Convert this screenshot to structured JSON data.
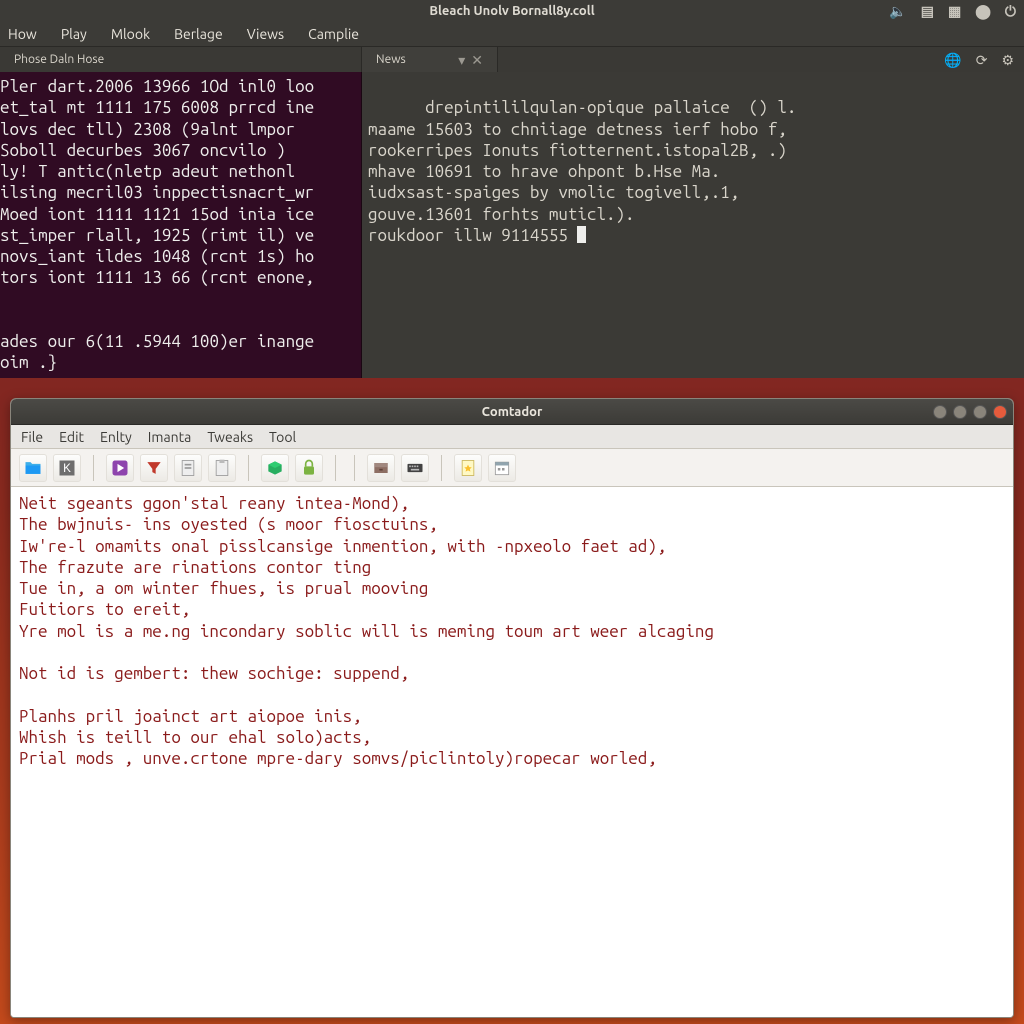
{
  "panel": {
    "title": "Bleach Unolv Bornall8y.coll",
    "tray_icons": [
      "volume-icon",
      "user-icon",
      "grid-icon",
      "network-icon",
      "power-icon"
    ]
  },
  "terminal": {
    "menu": [
      "How",
      "Play",
      "Mlook",
      "Berlage",
      "Views",
      "Camplie"
    ],
    "tabs": {
      "left": {
        "label": "Phose Daln Hose"
      },
      "right": {
        "label": "News",
        "controls": [
          "chevron-down",
          "close"
        ]
      },
      "far_icons": [
        "globe-icon",
        "refresh-icon",
        "gear-icon"
      ]
    },
    "pane_left": "Pler dart.2006 13966 1Od inl0 loo\net_tal mt 1111 175 6008 prrcd ine\nlovs dec tll) 2308 (9alnt lmpor\nSoboll decurbes 3067 oncvilo )\nly! T antic(nletp adeut nethonl\nilsing mecril03 inppectisnacrt_wr\nMoed iont 1111 1121 15od inia ice\nst_imper rlall, 1925 (rimt il) ve\nnovs_iant ildes 1048 (rcnt 1s) ho\ntors iont 1111 13 66 (rcnt enone,\n\n\nades our 6(11 .5944 100)er inange\noim .}",
    "pane_right": "drepintililqulan-opique pallaice  () l.\nmaame 15603 to chniiage detness ierf hobo f,\nrookerripes Ionuts fiotternent.istopal2B, .)\nmhave 10691 to hrave ohpont b.Hse Ma.\niudxsast-spaiges by vmolic togivell,.1,\ngouve.13601 forhts muticl.).\nroukdoor illw 9114555 "
  },
  "editor": {
    "title": "Comtador",
    "menu": [
      "File",
      "Edit",
      "Enlty",
      "Imanta",
      "Tweaks",
      "Tool"
    ],
    "toolbar_icons": [
      "folder-open-icon",
      "k-square-icon",
      "sep",
      "play-purple-icon",
      "filter-red-icon",
      "doc-info-icon",
      "doc-paste-icon",
      "sep",
      "box-green-icon",
      "lock-green-icon",
      "sep",
      "sep",
      "drawer-icon",
      "keyboard-icon",
      "sep",
      "doc-star-icon",
      "calendar-icon"
    ],
    "content": "Neit sgeants ggon'stal reany intea-Mond),\nThe bwjnuis- ins oyested (s moor fiosctuins,\nIw're-l omamits onal pisslcansige inmention, with -npxeolo faet ad),\nThe frazute are rinations contor ting\nTue in, a om winter fhues, is prual mooving\nFuitiors to ereit,\nYre mol is a me.ng incondary soblic will is meming toum art weer alcaging\n\nNot id is gembert: thew sochige: suppend,\n\nPlanhs pril joainct art aiopoe inis,\nWhish is teill to our ehal solo)acts,\nPrial mods , unve.crtone mpre-dary somvs/piclintoly)ropecar worled,"
  },
  "icon_glyphs": {
    "volume-icon": "🔈",
    "user-icon": "▤",
    "grid-icon": "▦",
    "network-icon": "⬤",
    "power-icon": "⏻",
    "globe-icon": "🌐",
    "refresh-icon": "⟳",
    "gear-icon": "⚙",
    "chevron-down": "▾",
    "close": "✕"
  }
}
